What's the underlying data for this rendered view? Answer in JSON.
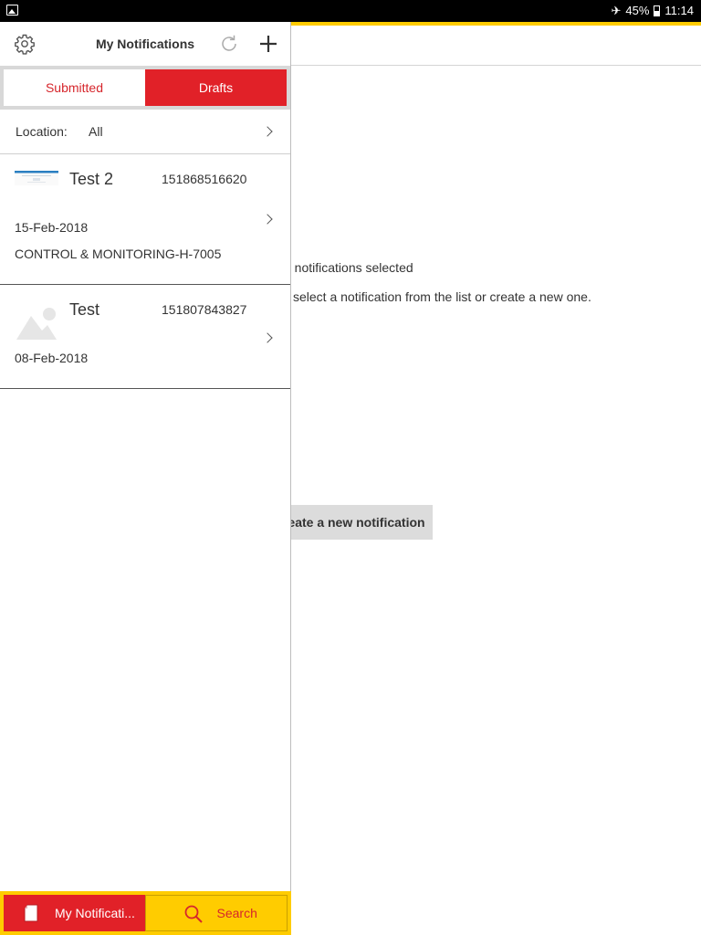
{
  "status_bar": {
    "battery": "45%",
    "time": "11:14"
  },
  "header": {
    "title": "My Notifications",
    "icons": {
      "settings": "gear-icon",
      "refresh": "refresh-icon",
      "add": "plus-icon"
    }
  },
  "tabs": [
    {
      "label": "Submitted",
      "selected": false
    },
    {
      "label": "Drafts",
      "selected": true
    }
  ],
  "location_filter": {
    "label": "Location:",
    "value": "All"
  },
  "notifications": [
    {
      "title": "Test 2",
      "number": "151868516620",
      "date": "15-Feb-2018",
      "location": "CONTROL & MONITORING-H-7005",
      "thumbnail": "screenshot-thumbnail"
    },
    {
      "title": "Test",
      "number": "151807843827",
      "date": "08-Feb-2018",
      "location": "",
      "thumbnail": "image-placeholder-icon"
    }
  ],
  "detail": {
    "empty_title": "o notifications selected",
    "empty_subtitle": "select a notification from the list or create a new one.",
    "create_button": "eate a new notification"
  },
  "bottom_tabs": [
    {
      "label": "My Notificati...",
      "icon": "document-icon",
      "active": true
    },
    {
      "label": "Search",
      "icon": "search-icon",
      "active": false
    }
  ],
  "colors": {
    "brand_red": "#e12128",
    "brand_yellow": "#ffcc00"
  }
}
